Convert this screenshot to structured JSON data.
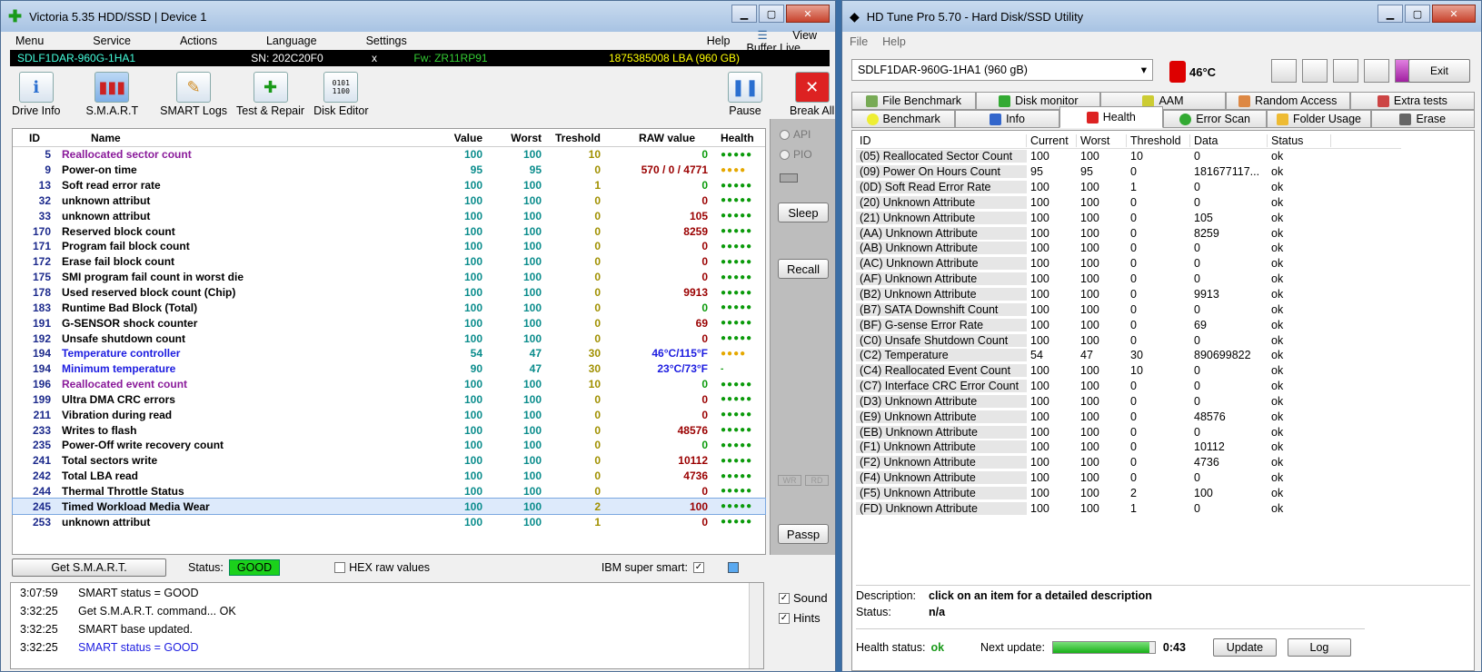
{
  "victoria": {
    "title": "Victoria 5.35 HDD/SSD | Device 1",
    "menu": [
      "Menu",
      "Service",
      "Actions",
      "Language",
      "Settings",
      "Help"
    ],
    "view_buffer_live": "View Buffer Live",
    "info": {
      "model": "SDLF1DAR-960G-1HA1",
      "sn": "SN: 202C20F0",
      "close": "x",
      "fw": "Fw: ZR11RP91",
      "lba": "1875385008 LBA (960 GB)"
    },
    "toolbar": [
      "Drive Info",
      "S.M.A.R.T",
      "SMART Logs",
      "Test & Repair",
      "Disk Editor"
    ],
    "pause": "Pause",
    "break_all": "Break All",
    "columns": [
      "ID",
      "Name",
      "Value",
      "Worst",
      "Treshold",
      "RAW value",
      "Health"
    ],
    "rows": [
      {
        "id": "5",
        "name": "Reallocated sector count",
        "value": "100",
        "worst": "100",
        "tres": "10",
        "raw": "0",
        "health": "●●●●●"
      },
      {
        "id": "9",
        "name": "Power-on time",
        "value": "95",
        "worst": "95",
        "tres": "0",
        "raw": "570 / 0 / 4771",
        "health": "●●●●"
      },
      {
        "id": "13",
        "name": "Soft read error rate",
        "value": "100",
        "worst": "100",
        "tres": "1",
        "raw": "0",
        "health": "●●●●●"
      },
      {
        "id": "32",
        "name": "unknown attribut",
        "value": "100",
        "worst": "100",
        "tres": "0",
        "raw": "0",
        "health": "●●●●●"
      },
      {
        "id": "33",
        "name": "unknown attribut",
        "value": "100",
        "worst": "100",
        "tres": "0",
        "raw": "105",
        "health": "●●●●●"
      },
      {
        "id": "170",
        "name": "Reserved block count",
        "value": "100",
        "worst": "100",
        "tres": "0",
        "raw": "8259",
        "health": "●●●●●"
      },
      {
        "id": "171",
        "name": "Program fail block count",
        "value": "100",
        "worst": "100",
        "tres": "0",
        "raw": "0",
        "health": "●●●●●"
      },
      {
        "id": "172",
        "name": "Erase fail block count",
        "value": "100",
        "worst": "100",
        "tres": "0",
        "raw": "0",
        "health": "●●●●●"
      },
      {
        "id": "175",
        "name": "SMI program fail count in worst die",
        "value": "100",
        "worst": "100",
        "tres": "0",
        "raw": "0",
        "health": "●●●●●"
      },
      {
        "id": "178",
        "name": "Used reserved block count (Chip)",
        "value": "100",
        "worst": "100",
        "tres": "0",
        "raw": "9913",
        "health": "●●●●●"
      },
      {
        "id": "183",
        "name": "Runtime Bad Block (Total)",
        "value": "100",
        "worst": "100",
        "tres": "0",
        "raw": "0",
        "health": "●●●●●"
      },
      {
        "id": "191",
        "name": "G-SENSOR shock counter",
        "value": "100",
        "worst": "100",
        "tres": "0",
        "raw": "69",
        "health": "●●●●●"
      },
      {
        "id": "192",
        "name": "Unsafe shutdown count",
        "value": "100",
        "worst": "100",
        "tres": "0",
        "raw": "0",
        "health": "●●●●●"
      },
      {
        "id": "194",
        "name": "Temperature controller",
        "value": "54",
        "worst": "47",
        "tres": "30",
        "raw": "46°C/115°F",
        "health": "●●●●"
      },
      {
        "id": "194",
        "name": "Minimum temperature",
        "value": "90",
        "worst": "47",
        "tres": "30",
        "raw": "23°C/73°F",
        "health": "-"
      },
      {
        "id": "196",
        "name": "Reallocated event count",
        "value": "100",
        "worst": "100",
        "tres": "10",
        "raw": "0",
        "health": "●●●●●"
      },
      {
        "id": "199",
        "name": "Ultra DMA CRC errors",
        "value": "100",
        "worst": "100",
        "tres": "0",
        "raw": "0",
        "health": "●●●●●"
      },
      {
        "id": "211",
        "name": "Vibration during read",
        "value": "100",
        "worst": "100",
        "tres": "0",
        "raw": "0",
        "health": "●●●●●"
      },
      {
        "id": "233",
        "name": "Writes to flash",
        "value": "100",
        "worst": "100",
        "tres": "0",
        "raw": "48576",
        "health": "●●●●●"
      },
      {
        "id": "235",
        "name": "Power-Off write recovery count",
        "value": "100",
        "worst": "100",
        "tres": "0",
        "raw": "0",
        "health": "●●●●●"
      },
      {
        "id": "241",
        "name": "Total sectors write",
        "value": "100",
        "worst": "100",
        "tres": "0",
        "raw": "10112",
        "health": "●●●●●"
      },
      {
        "id": "242",
        "name": "Total LBA read",
        "value": "100",
        "worst": "100",
        "tres": "0",
        "raw": "4736",
        "health": "●●●●●"
      },
      {
        "id": "244",
        "name": "Thermal Throttle Status",
        "value": "100",
        "worst": "100",
        "tres": "0",
        "raw": "0",
        "health": "●●●●●"
      },
      {
        "id": "245",
        "name": "Timed Workload Media Wear",
        "value": "100",
        "worst": "100",
        "tres": "2",
        "raw": "100",
        "health": "●●●●●"
      },
      {
        "id": "253",
        "name": "unknown attribut",
        "value": "100",
        "worst": "100",
        "tres": "1",
        "raw": "0",
        "health": "●●●●●"
      }
    ],
    "side": {
      "api": "API",
      "pio": "PIO",
      "sleep": "Sleep",
      "recall": "Recall",
      "wr": "WR",
      "rd": "RD",
      "passp": "Passp"
    },
    "status": {
      "get_smart": "Get S.M.A.R.T.",
      "status_label": "Status:",
      "status_value": "GOOD",
      "hex_raw": "HEX raw values",
      "ibm": "IBM super smart:"
    },
    "log": [
      {
        "time": "3:07:59",
        "msg": "SMART status = GOOD"
      },
      {
        "time": "3:32:25",
        "msg": "Get S.M.A.R.T. command... OK"
      },
      {
        "time": "3:32:25",
        "msg": "SMART base updated."
      },
      {
        "time": "3:32:25",
        "msg": "SMART status = GOOD"
      }
    ],
    "sound": "Sound",
    "hints": "Hints"
  },
  "hdtune": {
    "title": "HD Tune Pro 5.70 - Hard Disk/SSD Utility",
    "menu": [
      "File",
      "Help"
    ],
    "drive": "SDLF1DAR-960G-1HA1 (960 gB)",
    "temp": "46°C",
    "exit": "Exit",
    "tabs_top": [
      "File Benchmark",
      "Disk monitor",
      "AAM",
      "Random Access",
      "Extra tests"
    ],
    "tabs_bottom": [
      "Benchmark",
      "Info",
      "Health",
      "Error Scan",
      "Folder Usage",
      "Erase"
    ],
    "columns": [
      "ID",
      "Current",
      "Worst",
      "Threshold",
      "Data",
      "Status"
    ],
    "rows": [
      {
        "id": "(05) Reallocated Sector Count",
        "cur": "100",
        "worst": "100",
        "thr": "10",
        "data": "0",
        "status": "ok"
      },
      {
        "id": "(09) Power On Hours Count",
        "cur": "95",
        "worst": "95",
        "thr": "0",
        "data": "181677117...",
        "status": "ok"
      },
      {
        "id": "(0D) Soft Read Error Rate",
        "cur": "100",
        "worst": "100",
        "thr": "1",
        "data": "0",
        "status": "ok"
      },
      {
        "id": "(20) Unknown Attribute",
        "cur": "100",
        "worst": "100",
        "thr": "0",
        "data": "0",
        "status": "ok"
      },
      {
        "id": "(21) Unknown Attribute",
        "cur": "100",
        "worst": "100",
        "thr": "0",
        "data": "105",
        "status": "ok"
      },
      {
        "id": "(AA) Unknown Attribute",
        "cur": "100",
        "worst": "100",
        "thr": "0",
        "data": "8259",
        "status": "ok"
      },
      {
        "id": "(AB) Unknown Attribute",
        "cur": "100",
        "worst": "100",
        "thr": "0",
        "data": "0",
        "status": "ok"
      },
      {
        "id": "(AC) Unknown Attribute",
        "cur": "100",
        "worst": "100",
        "thr": "0",
        "data": "0",
        "status": "ok"
      },
      {
        "id": "(AF) Unknown Attribute",
        "cur": "100",
        "worst": "100",
        "thr": "0",
        "data": "0",
        "status": "ok"
      },
      {
        "id": "(B2) Unknown Attribute",
        "cur": "100",
        "worst": "100",
        "thr": "0",
        "data": "9913",
        "status": "ok"
      },
      {
        "id": "(B7) SATA Downshift Count",
        "cur": "100",
        "worst": "100",
        "thr": "0",
        "data": "0",
        "status": "ok"
      },
      {
        "id": "(BF) G-sense Error Rate",
        "cur": "100",
        "worst": "100",
        "thr": "0",
        "data": "69",
        "status": "ok"
      },
      {
        "id": "(C0) Unsafe Shutdown Count",
        "cur": "100",
        "worst": "100",
        "thr": "0",
        "data": "0",
        "status": "ok"
      },
      {
        "id": "(C2) Temperature",
        "cur": "54",
        "worst": "47",
        "thr": "30",
        "data": "890699822",
        "status": "ok"
      },
      {
        "id": "(C4) Reallocated Event Count",
        "cur": "100",
        "worst": "100",
        "thr": "10",
        "data": "0",
        "status": "ok"
      },
      {
        "id": "(C7) Interface CRC Error Count",
        "cur": "100",
        "worst": "100",
        "thr": "0",
        "data": "0",
        "status": "ok"
      },
      {
        "id": "(D3) Unknown Attribute",
        "cur": "100",
        "worst": "100",
        "thr": "0",
        "data": "0",
        "status": "ok"
      },
      {
        "id": "(E9) Unknown Attribute",
        "cur": "100",
        "worst": "100",
        "thr": "0",
        "data": "48576",
        "status": "ok"
      },
      {
        "id": "(EB) Unknown Attribute",
        "cur": "100",
        "worst": "100",
        "thr": "0",
        "data": "0",
        "status": "ok"
      },
      {
        "id": "(F1) Unknown Attribute",
        "cur": "100",
        "worst": "100",
        "thr": "0",
        "data": "10112",
        "status": "ok"
      },
      {
        "id": "(F2) Unknown Attribute",
        "cur": "100",
        "worst": "100",
        "thr": "0",
        "data": "4736",
        "status": "ok"
      },
      {
        "id": "(F4) Unknown Attribute",
        "cur": "100",
        "worst": "100",
        "thr": "0",
        "data": "0",
        "status": "ok"
      },
      {
        "id": "(F5) Unknown Attribute",
        "cur": "100",
        "worst": "100",
        "thr": "2",
        "data": "100",
        "status": "ok"
      },
      {
        "id": "(FD) Unknown Attribute",
        "cur": "100",
        "worst": "100",
        "thr": "1",
        "data": "0",
        "status": "ok"
      }
    ],
    "description_label": "Description:",
    "description": "click on an item for a detailed description",
    "status_label": "Status:",
    "status_value": "n/a",
    "health_status_label": "Health status:",
    "health_status": "ok",
    "next_update_label": "Next update:",
    "next_update_progress": 0.95,
    "next_update": "0:43",
    "update": "Update",
    "log": "Log"
  }
}
